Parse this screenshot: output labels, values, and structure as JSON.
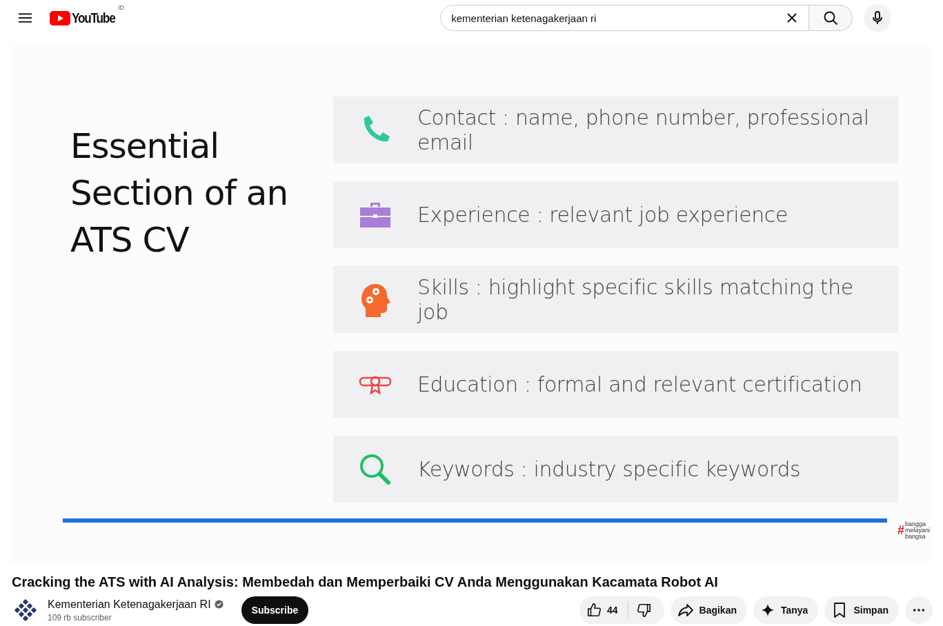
{
  "header": {
    "logo_text": "YouTube",
    "country_code": "ID",
    "search": {
      "value": "kementerian ketenagakerjaan ri"
    }
  },
  "video": {
    "slide": {
      "title": "Essential Section of an ATS CV",
      "items": [
        {
          "kind": "phone",
          "text": "Contact : name, phone number, professional email",
          "color": "#2ec99a"
        },
        {
          "kind": "briefcase",
          "text": "Experience : relevant job experience",
          "color": "#a97ed6"
        },
        {
          "kind": "head",
          "text": "Skills : highlight specific skills matching the job",
          "color": "#f5692e"
        },
        {
          "kind": "diploma",
          "text": "Education : formal and relevant certification",
          "color": "#e8474b"
        },
        {
          "kind": "search",
          "text": "Keywords : industry specific keywords",
          "color": "#1fbf63"
        }
      ],
      "watermark": {
        "hash": "#",
        "lines": [
          "bangga",
          "melayani",
          "bangsa"
        ]
      }
    }
  },
  "title": "Cracking the ATS with AI Analysis: Membedah dan Memperbaiki CV Anda Menggunakan Kacamata Robot AI",
  "channel": {
    "name": "Kementerian Ketenagakerjaan RI",
    "verified": true,
    "subscribers": "109 rb subscriber",
    "subscribe_label": "Subscribe"
  },
  "actions": {
    "likes": "44",
    "buttons": [
      {
        "kind": "share",
        "label": "Bagikan"
      },
      {
        "kind": "ask",
        "label": "Tanya"
      },
      {
        "kind": "save",
        "label": "Simpan"
      }
    ]
  }
}
